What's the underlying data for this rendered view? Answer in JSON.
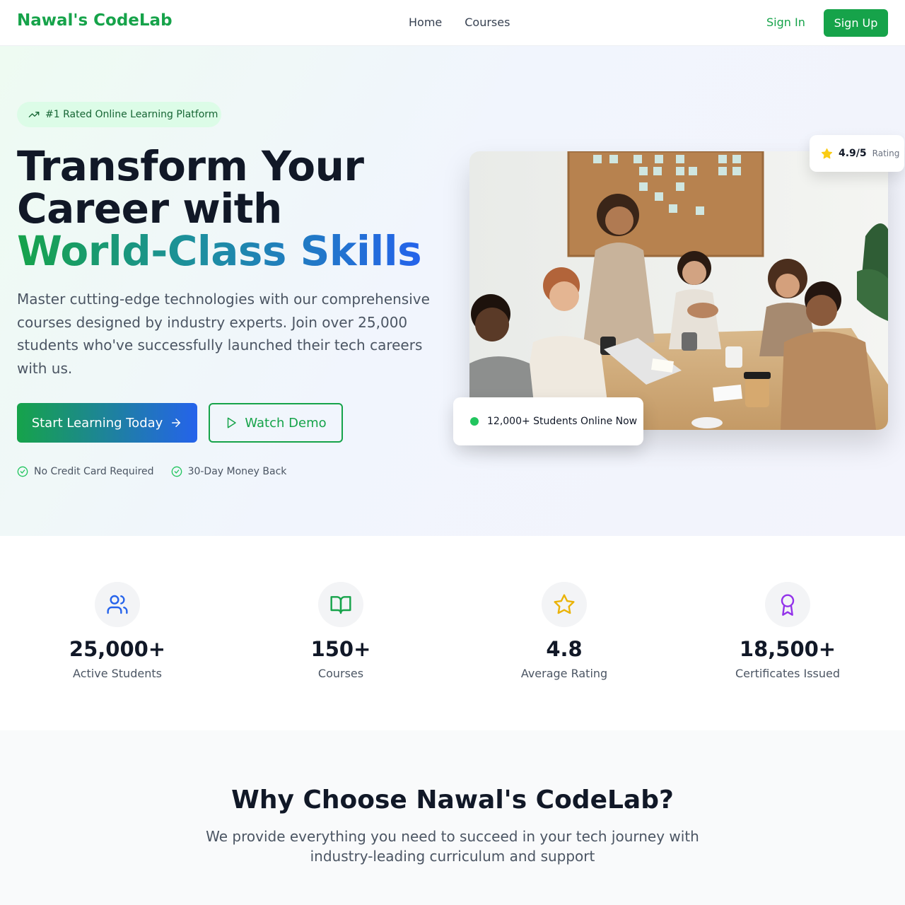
{
  "nav": {
    "brand": "Nawal's CodeLab",
    "links": [
      "Home",
      "Courses"
    ],
    "sign_in": "Sign In",
    "sign_up": "Sign Up"
  },
  "hero": {
    "badge": "#1 Rated Online Learning Platform",
    "title_line1": "Transform Your",
    "title_line2": "Career with",
    "title_highlight": "World-Class Skills",
    "lead": "Master cutting-edge technologies with our comprehensive courses designed by industry experts. Join over 25,000 students who've successfully launched their tech careers with us.",
    "primary_cta": "Start Learning Today",
    "secondary_cta": "Watch Demo",
    "checks": [
      "No Credit Card Required",
      "30-Day Money Back"
    ],
    "rating_value": "4.9/5",
    "rating_label": "Rating",
    "online_text": "12,000+ Students Online Now"
  },
  "stats": [
    {
      "icon": "users-icon",
      "value": "25,000+",
      "label": "Active Students",
      "color": "#2563eb"
    },
    {
      "icon": "book-open-icon",
      "value": "150+",
      "label": "Courses",
      "color": "#16a34a"
    },
    {
      "icon": "star-icon",
      "value": "4.8",
      "label": "Average Rating",
      "color": "#eab308"
    },
    {
      "icon": "award-icon",
      "value": "18,500+",
      "label": "Certificates Issued",
      "color": "#9333ea"
    }
  ],
  "why": {
    "title": "Why Choose Nawal's CodeLab?",
    "subtitle": "We provide everything you need to succeed in your tech journey with industry-leading curriculum and support"
  }
}
